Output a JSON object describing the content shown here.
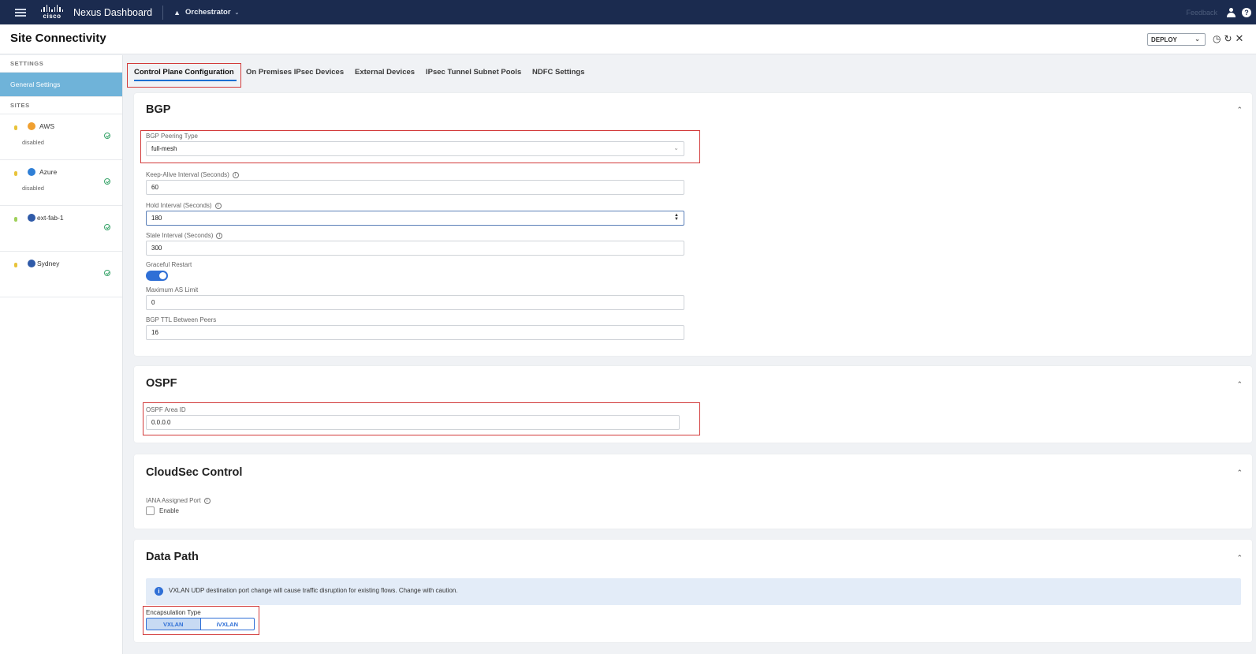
{
  "topbar": {
    "logo_text": "cisco",
    "app_name": "Nexus Dashboard",
    "orchestrator": "Orchestrator",
    "feedback": "Feedback"
  },
  "header": {
    "title": "Site Connectivity",
    "deploy_label": "DEPLOY"
  },
  "sidebar": {
    "settings_heading": "SETTINGS",
    "general_settings": "General Settings",
    "sites_heading": "SITES",
    "sites": [
      {
        "name": "AWS",
        "status": "disabled",
        "logo_color": "#f0a030"
      },
      {
        "name": "Azure",
        "status": "disabled",
        "logo_color": "#2f7fd6"
      },
      {
        "name": "ext-fab-1",
        "status": "",
        "logo_color": "#2f5aa8"
      },
      {
        "name": "Sydney",
        "status": "",
        "logo_color": "#2f5aa8"
      }
    ]
  },
  "tabs": [
    {
      "label": "Control Plane Configuration",
      "active": true
    },
    {
      "label": "On Premises IPsec Devices",
      "active": false
    },
    {
      "label": "External Devices",
      "active": false
    },
    {
      "label": "IPsec Tunnel Subnet Pools",
      "active": false
    },
    {
      "label": "NDFC Settings",
      "active": false
    }
  ],
  "bgp": {
    "title": "BGP",
    "peering_type_label": "BGP Peering Type",
    "peering_type_value": "full-mesh",
    "keepalive_label": "Keep-Alive Interval (Seconds)",
    "keepalive_value": "60",
    "hold_label": "Hold Interval (Seconds)",
    "hold_value": "180",
    "stale_label": "Stale Interval (Seconds)",
    "stale_value": "300",
    "graceful_label": "Graceful Restart",
    "graceful_on": true,
    "max_as_label": "Maximum AS Limit",
    "max_as_value": "0",
    "ttl_label": "BGP TTL Between Peers",
    "ttl_value": "16"
  },
  "ospf": {
    "title": "OSPF",
    "area_label": "OSPF Area ID",
    "area_value": "0.0.0.0"
  },
  "cloudsec": {
    "title": "CloudSec Control",
    "port_label": "IANA Assigned Port",
    "enable_label": "Enable",
    "enabled": false
  },
  "datapath": {
    "title": "Data Path",
    "alert_text": "VXLAN UDP destination port change will cause traffic disruption for existing flows. Change with caution.",
    "encap_label": "Encapsulation Type",
    "encap_options": [
      "VXLAN",
      "iVXLAN"
    ],
    "encap_selected": "VXLAN"
  },
  "colors": {
    "topbar": "#1b2b4f",
    "accent": "#2f6fd6",
    "sidebar_active": "#6fb3d9",
    "highlight_box": "#d23a3a",
    "success": "#39a46a"
  }
}
